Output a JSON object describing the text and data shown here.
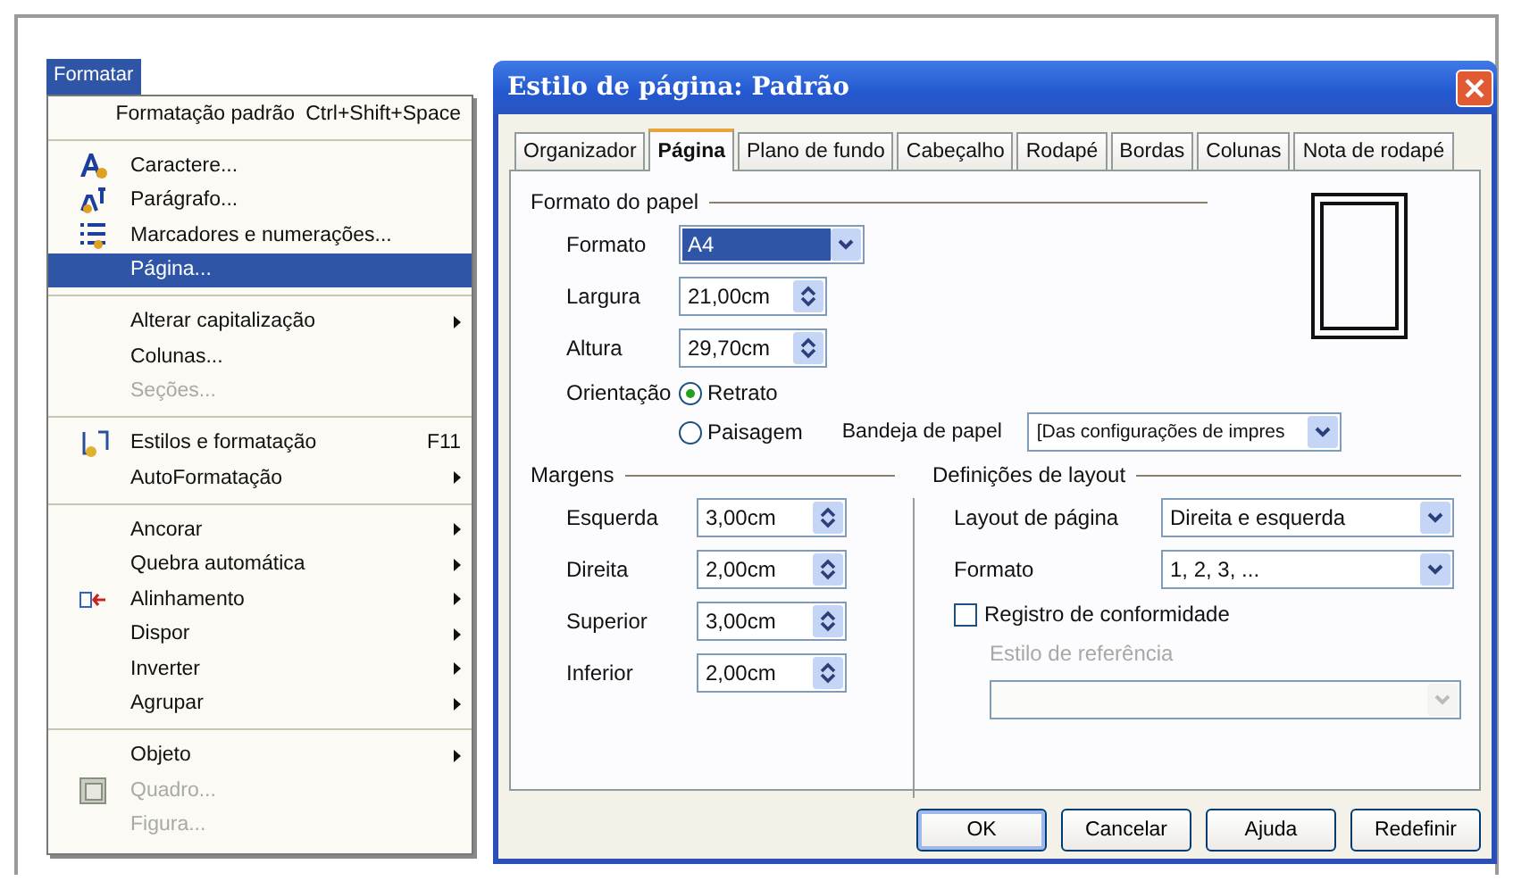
{
  "menu": {
    "title": "Formatar",
    "items": [
      {
        "kind": "item",
        "label": "Formatação padrão",
        "shortcut": "Ctrl+Shift+Space",
        "submenu": false,
        "disabled": false,
        "selected": false
      },
      {
        "kind": "separator"
      },
      {
        "kind": "item",
        "label": "Caractere...",
        "submenu": false,
        "disabled": false,
        "selected": false
      },
      {
        "kind": "item",
        "label": "Parágrafo...",
        "submenu": false,
        "disabled": false,
        "selected": false
      },
      {
        "kind": "item",
        "label": "Marcadores e numerações...",
        "submenu": false,
        "disabled": false,
        "selected": false
      },
      {
        "kind": "item",
        "label": "Página...",
        "submenu": false,
        "disabled": false,
        "selected": true
      },
      {
        "kind": "separator"
      },
      {
        "kind": "item",
        "label": "Alterar capitalização",
        "submenu": true,
        "disabled": false,
        "selected": false
      },
      {
        "kind": "item",
        "label": "Colunas...",
        "submenu": false,
        "disabled": false,
        "selected": false
      },
      {
        "kind": "item",
        "label": "Seções...",
        "submenu": false,
        "disabled": true,
        "selected": false
      },
      {
        "kind": "separator"
      },
      {
        "kind": "item",
        "label": "Estilos e formatação",
        "shortcut": "F11",
        "submenu": false,
        "disabled": false,
        "selected": false
      },
      {
        "kind": "item",
        "label": "AutoFormatação",
        "submenu": true,
        "disabled": false,
        "selected": false
      },
      {
        "kind": "separator"
      },
      {
        "kind": "item",
        "label": "Ancorar",
        "submenu": true,
        "disabled": false,
        "selected": false
      },
      {
        "kind": "item",
        "label": "Quebra automática",
        "submenu": true,
        "disabled": false,
        "selected": false
      },
      {
        "kind": "item",
        "label": "Alinhamento",
        "submenu": true,
        "disabled": false,
        "selected": false
      },
      {
        "kind": "item",
        "label": "Dispor",
        "submenu": true,
        "disabled": false,
        "selected": false
      },
      {
        "kind": "item",
        "label": "Inverter",
        "submenu": true,
        "disabled": false,
        "selected": false
      },
      {
        "kind": "item",
        "label": "Agrupar",
        "submenu": true,
        "disabled": false,
        "selected": false
      },
      {
        "kind": "separator"
      },
      {
        "kind": "item",
        "label": "Objeto",
        "submenu": true,
        "disabled": false,
        "selected": false
      },
      {
        "kind": "item",
        "label": "Quadro...",
        "submenu": false,
        "disabled": true,
        "selected": false
      },
      {
        "kind": "item",
        "label": "Figura...",
        "submenu": false,
        "disabled": true,
        "selected": false
      }
    ]
  },
  "dialog": {
    "title": "Estilo de página: Padrão",
    "tabs": [
      {
        "label": "Organizador",
        "selected": false
      },
      {
        "label": "Página",
        "selected": true
      },
      {
        "label": "Plano de fundo",
        "selected": false
      },
      {
        "label": "Cabeçalho",
        "selected": false
      },
      {
        "label": "Rodapé",
        "selected": false
      },
      {
        "label": "Bordas",
        "selected": false
      },
      {
        "label": "Colunas",
        "selected": false
      },
      {
        "label": "Nota de rodapé",
        "selected": false
      }
    ],
    "paper_format": {
      "heading": "Formato do papel",
      "format": {
        "label": "Formato",
        "value": "A4"
      },
      "width": {
        "label": "Largura",
        "value": "21,00cm"
      },
      "height": {
        "label": "Altura",
        "value": "29,70cm"
      },
      "orientation": {
        "label": "Orientação",
        "options": [
          {
            "label": "Retrato",
            "selected": true
          },
          {
            "label": "Paisagem",
            "selected": false
          }
        ]
      },
      "tray": {
        "label": "Bandeja de papel",
        "value": "[Das configurações de impres"
      }
    },
    "margins": {
      "heading": "Margens",
      "fields": [
        {
          "label": "Esquerda",
          "value": "3,00cm"
        },
        {
          "label": "Direita",
          "value": "2,00cm"
        },
        {
          "label": "Superior",
          "value": "3,00cm"
        },
        {
          "label": "Inferior",
          "value": "2,00cm"
        }
      ]
    },
    "layout": {
      "heading": "Definições de layout",
      "page_layout": {
        "label": "Layout de página",
        "value": "Direita e esquerda"
      },
      "number_format": {
        "label": "Formato",
        "value": "1, 2, 3, ..."
      },
      "register": {
        "label": "Registro de conformidade",
        "checked": false
      },
      "reference": {
        "label": "Estilo de referência",
        "disabled": true
      }
    },
    "buttons": [
      {
        "label": "OK",
        "default": true
      },
      {
        "label": "Cancelar",
        "default": false
      },
      {
        "label": "Ajuda",
        "default": false
      },
      {
        "label": "Redefinir",
        "default": false
      }
    ]
  }
}
